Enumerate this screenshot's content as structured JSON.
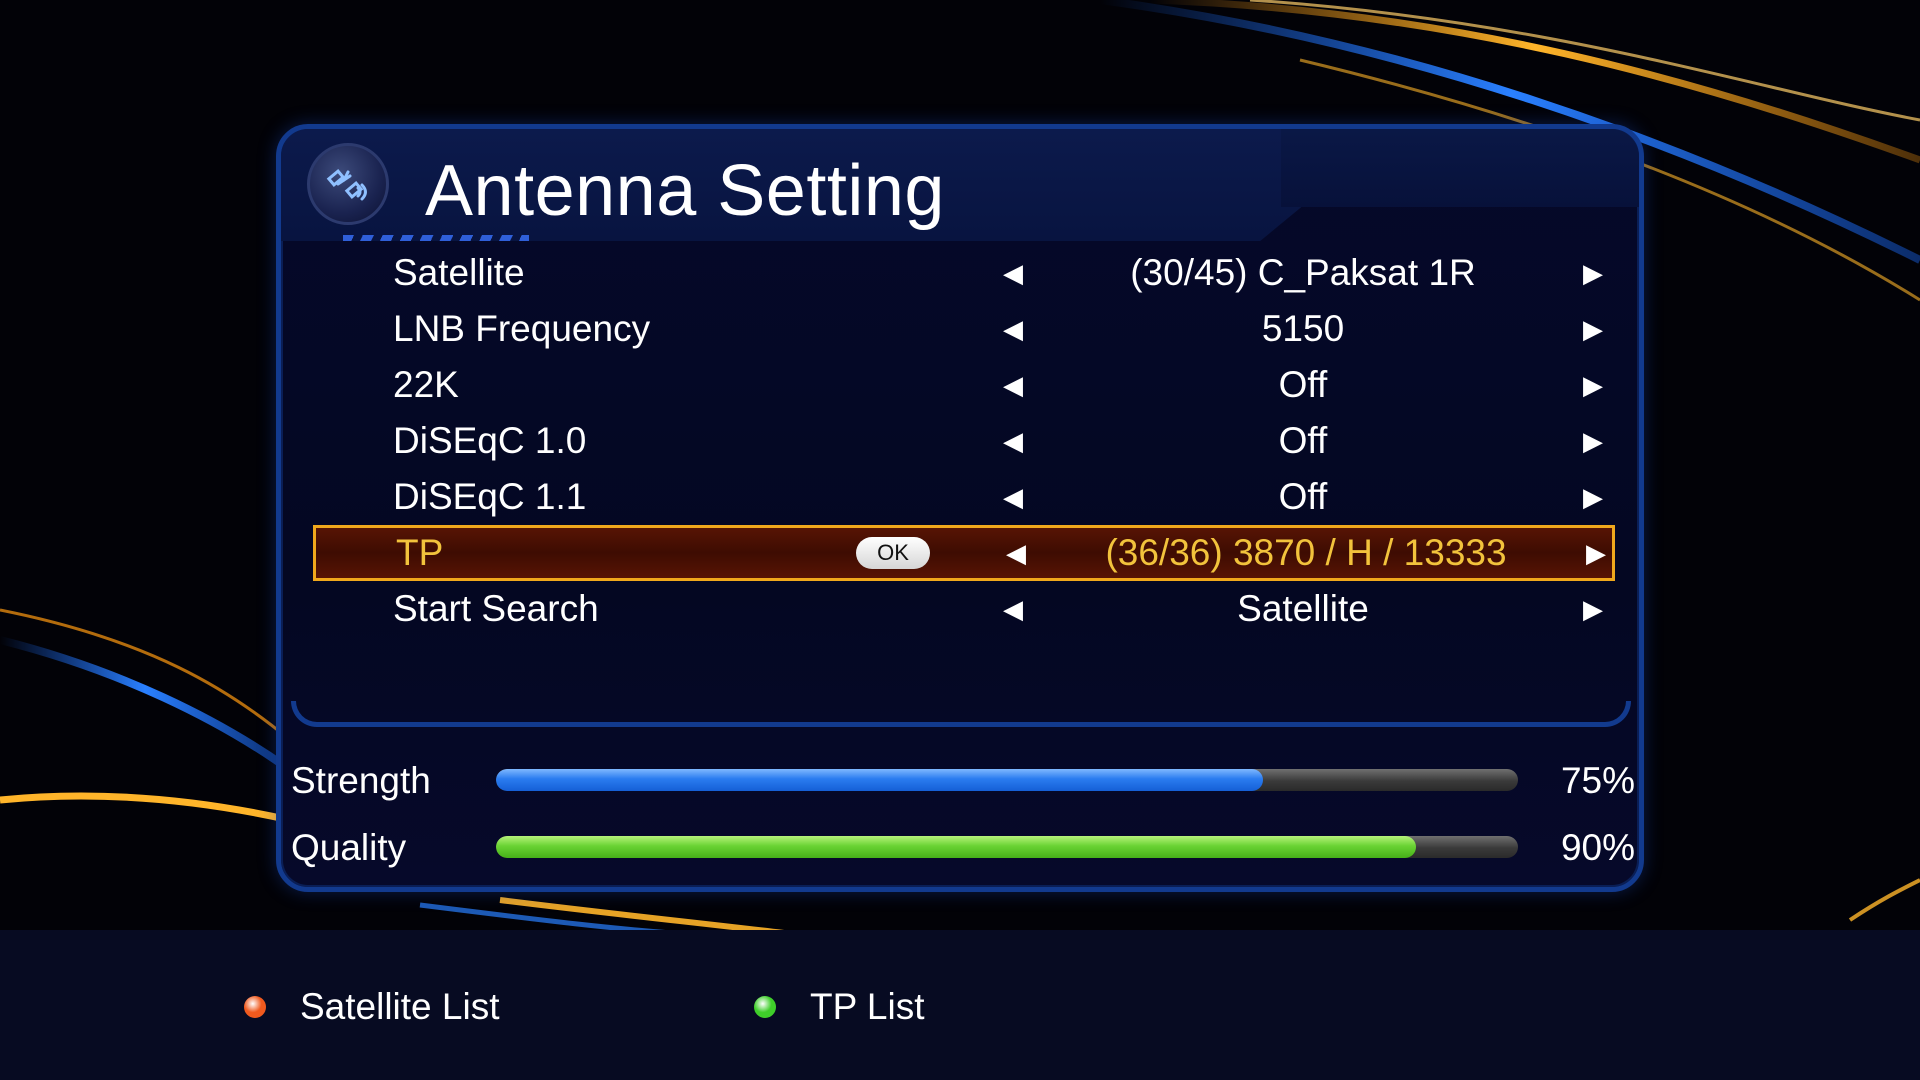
{
  "window": {
    "title": "Antenna Setting"
  },
  "header": {
    "icon": "satellite-icon"
  },
  "settings": {
    "rows": [
      {
        "label": "Satellite",
        "value": "(30/45) C_Paksat 1R"
      },
      {
        "label": "LNB Frequency",
        "value": "5150"
      },
      {
        "label": "22K",
        "value": "Off"
      },
      {
        "label": "DiSEqC 1.0",
        "value": "Off"
      },
      {
        "label": "DiSEqC 1.1",
        "value": "Off"
      },
      {
        "label": "TP",
        "value": "(36/36) 3870 / H / 13333",
        "selected": true,
        "badge": "OK"
      },
      {
        "label": "Start Search",
        "value": "Satellite"
      }
    ],
    "arrow_left": "◀",
    "arrow_right": "▶"
  },
  "signal": {
    "strength": {
      "label": "Strength",
      "percent": 75,
      "display": "75%",
      "color": "#2a7cf0"
    },
    "quality": {
      "label": "Quality",
      "percent": 90,
      "display": "90%",
      "color": "#6ad334"
    }
  },
  "footer": {
    "items": [
      {
        "label": "Satellite List",
        "color_key": "red",
        "color": "#f05a1e"
      },
      {
        "label": "TP List",
        "color_key": "green",
        "color": "#3fcf2a"
      }
    ]
  },
  "colors": {
    "accent_blue": "#123a8e",
    "selected_border": "#f0a81c",
    "selected_text": "#f2c33c",
    "selected_bg": "#571404"
  }
}
